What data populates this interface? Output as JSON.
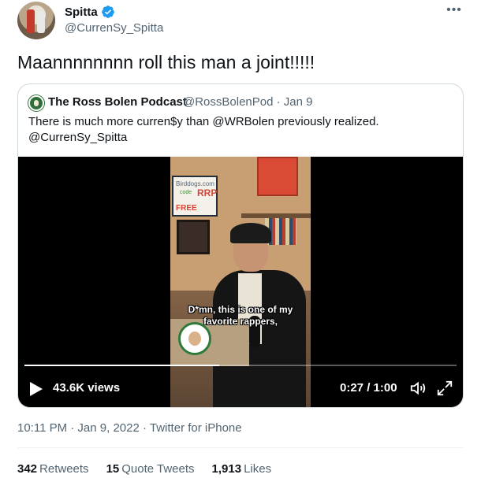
{
  "tweet": {
    "display_name": "Spitta",
    "handle": "@CurrenSy_Spitta",
    "text": "Maannnnnnnn roll this man a joint!!!!!",
    "more_symbol": "•••"
  },
  "quote": {
    "name": "The Ross Bolen Podcast",
    "meta": "@RossBolenPod · Jan 9",
    "text": "There is much more curren$y than @WRBolen previously realized. @CurrenSy_Spitta"
  },
  "video": {
    "caption": "D*mn, this is one of my favorite rappers,",
    "views": "43.6K views",
    "timer": "0:27 / 1:00",
    "progress": 0.45,
    "sign_lines": [
      "Birddogs.com",
      "code",
      "RRP",
      "FREE"
    ],
    "logo_text": "THE ROSS BOLEN PODCAST"
  },
  "footer": {
    "time": "10:11 PM · Jan 9, 2022 · ",
    "source": "Twitter for iPhone"
  },
  "stats": {
    "retweets_count": "342",
    "retweets_label": "Retweets",
    "quotes_count": "15",
    "quotes_label": "Quote Tweets",
    "likes_count": "1,913",
    "likes_label": "Likes"
  },
  "colors": {
    "verified": "#1d9bf0",
    "text_primary": "#0f1419",
    "text_secondary": "#536471",
    "border": "#cfd9de"
  },
  "icons": [
    "verified-badge-icon",
    "more-icon",
    "play-icon",
    "volume-icon",
    "fullscreen-icon"
  ]
}
